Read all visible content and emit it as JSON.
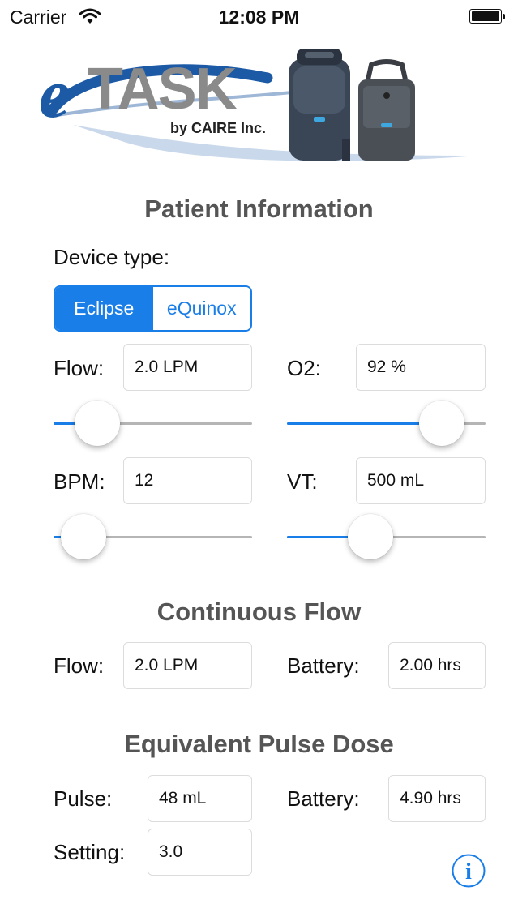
{
  "status_bar": {
    "carrier": "Carrier",
    "time": "12:08 PM"
  },
  "logo": {
    "brand": "eTASK",
    "byline": "by CAIRE Inc."
  },
  "patient_info": {
    "title": "Patient Information",
    "device_type_label": "Device type:",
    "device_options": [
      "Eclipse",
      "eQuinox"
    ],
    "selected_device": "Eclipse",
    "flow": {
      "label": "Flow:",
      "value": "2.0 LPM",
      "slider_fraction": 0.22
    },
    "o2": {
      "label": "O2:",
      "value": "92 %",
      "slider_fraction": 0.78
    },
    "bpm": {
      "label": "BPM:",
      "value": "12",
      "slider_fraction": 0.15
    },
    "vt": {
      "label": "VT:",
      "value": "500 mL",
      "slider_fraction": 0.42
    }
  },
  "continuous_flow": {
    "title": "Continuous Flow",
    "flow": {
      "label": "Flow:",
      "value": "2.0 LPM"
    },
    "battery": {
      "label": "Battery:",
      "value": "2.00 hrs"
    }
  },
  "pulse_dose": {
    "title": "Equivalent Pulse Dose",
    "pulse": {
      "label": "Pulse:",
      "value": "48 mL"
    },
    "battery": {
      "label": "Battery:",
      "value": "4.90 hrs"
    },
    "setting": {
      "label": "Setting:",
      "value": "3.0"
    }
  },
  "colors": {
    "accent": "#1a7ee8",
    "heading": "#555555",
    "logo_blue": "#1c5aa6",
    "logo_gray": "#8a8a8a"
  },
  "icons": {
    "info": "info-icon",
    "wifi": "wifi-icon",
    "battery": "battery-icon"
  }
}
